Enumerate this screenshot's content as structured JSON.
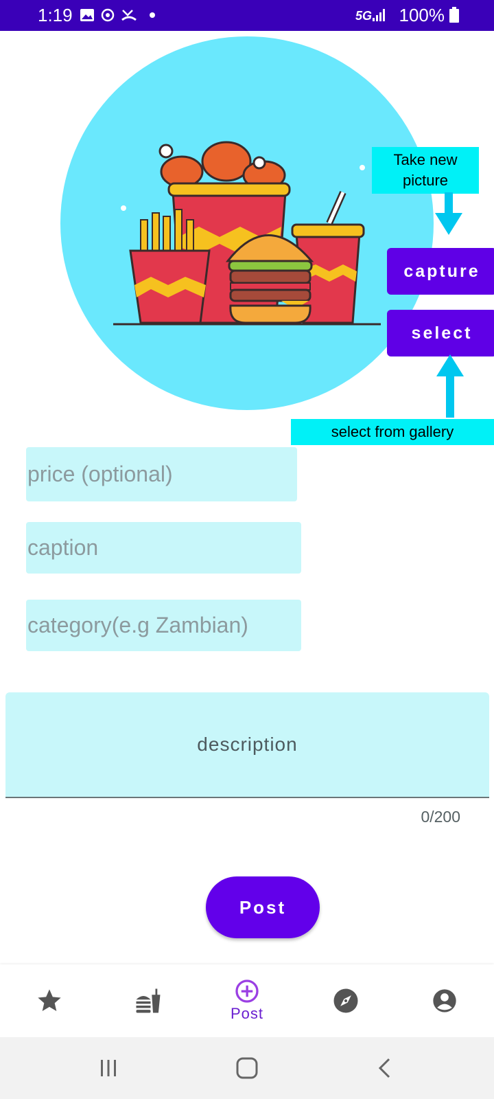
{
  "status_bar": {
    "time": "1:19",
    "network": "5G",
    "battery": "100%",
    "icons": [
      "gallery-icon",
      "sync-icon",
      "missed-call-icon",
      "dot-icon",
      "signal-icon",
      "battery-icon"
    ]
  },
  "hero": {
    "annotation_top": "Take new picture",
    "annotation_bottom": "select from gallery",
    "capture_label": "capture",
    "select_label": "select",
    "circle_color": "#6ae8fd"
  },
  "form": {
    "price_placeholder": "price (optional)",
    "caption_placeholder": "caption",
    "category_placeholder": "category(e.g Zambian)",
    "description_placeholder": "description",
    "char_counter": "0/200"
  },
  "post_button": {
    "label": "Post"
  },
  "bottom_nav": {
    "items": [
      {
        "icon": "star-icon",
        "label": ""
      },
      {
        "icon": "fastfood-icon",
        "label": ""
      },
      {
        "icon": "add-circle-icon",
        "label": "Post"
      },
      {
        "icon": "compass-icon",
        "label": ""
      },
      {
        "icon": "account-icon",
        "label": ""
      }
    ],
    "active_index": 2
  },
  "colors": {
    "status_bar": "#3a00b8",
    "accent": "#6200ea",
    "annotation": "#00f1f7",
    "field_bg": "#c8f7fa"
  }
}
